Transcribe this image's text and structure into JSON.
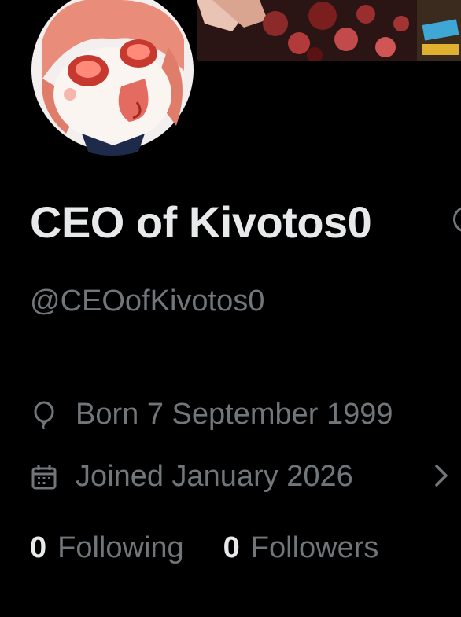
{
  "profile": {
    "display_name": "CEO of Kivotos0",
    "handle": "@CEOofKivotos0",
    "birth": "Born 7 September 1999",
    "joined": "Joined January 2026",
    "following_count": "0",
    "following_label": "Following",
    "followers_count": "0",
    "followers_label": "Followers"
  },
  "icons": {
    "birth": "balloon-icon",
    "joined": "calendar-icon",
    "joined_more": "chevron-right-icon",
    "verified": "verified-badge-icon"
  },
  "colors": {
    "background": "#000000",
    "primary_text": "#e7e9ea",
    "secondary_text": "#71767b"
  }
}
